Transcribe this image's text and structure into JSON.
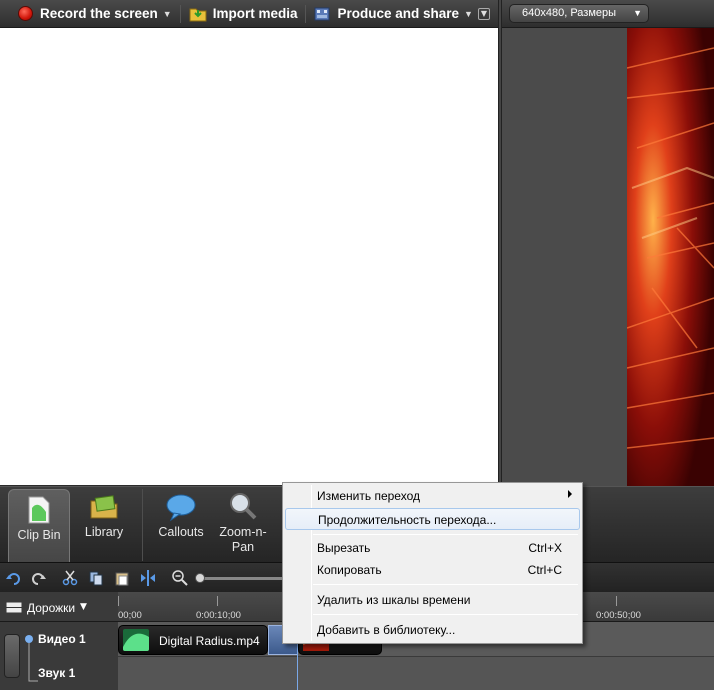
{
  "toolbar": {
    "record_label": "Record the screen",
    "import_label": "Import media",
    "produce_label": "Produce and share"
  },
  "preview": {
    "size_select": "640x480, Размеры"
  },
  "tools": {
    "clip_bin": "Clip Bin",
    "library": "Library",
    "callouts": "Callouts",
    "zoom_n_pan_1": "Zoom-n-",
    "zoom_n_pan_2": "Pan"
  },
  "timeline": {
    "tracks_label": "Дорожки",
    "ruler": [
      "00;00",
      "0:00:10;00",
      "0:00:50;00"
    ],
    "track_video": "Видео 1",
    "track_audio": "Звук 1",
    "clip1_label": "Digital Radius.mp4"
  },
  "context_menu": {
    "items": [
      {
        "label": "Изменить переход",
        "shortcut": ""
      },
      {
        "label": "Продолжительность перехода...",
        "shortcut": ""
      },
      {
        "label": "Вырезать",
        "shortcut": "Ctrl+X"
      },
      {
        "label": "Копировать",
        "shortcut": "Ctrl+C"
      },
      {
        "label": "Удалить из шкалы времени",
        "shortcut": ""
      },
      {
        "label": "Добавить в библиотеку...",
        "shortcut": ""
      }
    ]
  },
  "colors": {
    "record": "#d0150a",
    "menu_highlight": "#a8c8ec",
    "transition": "#3c5a8c"
  }
}
